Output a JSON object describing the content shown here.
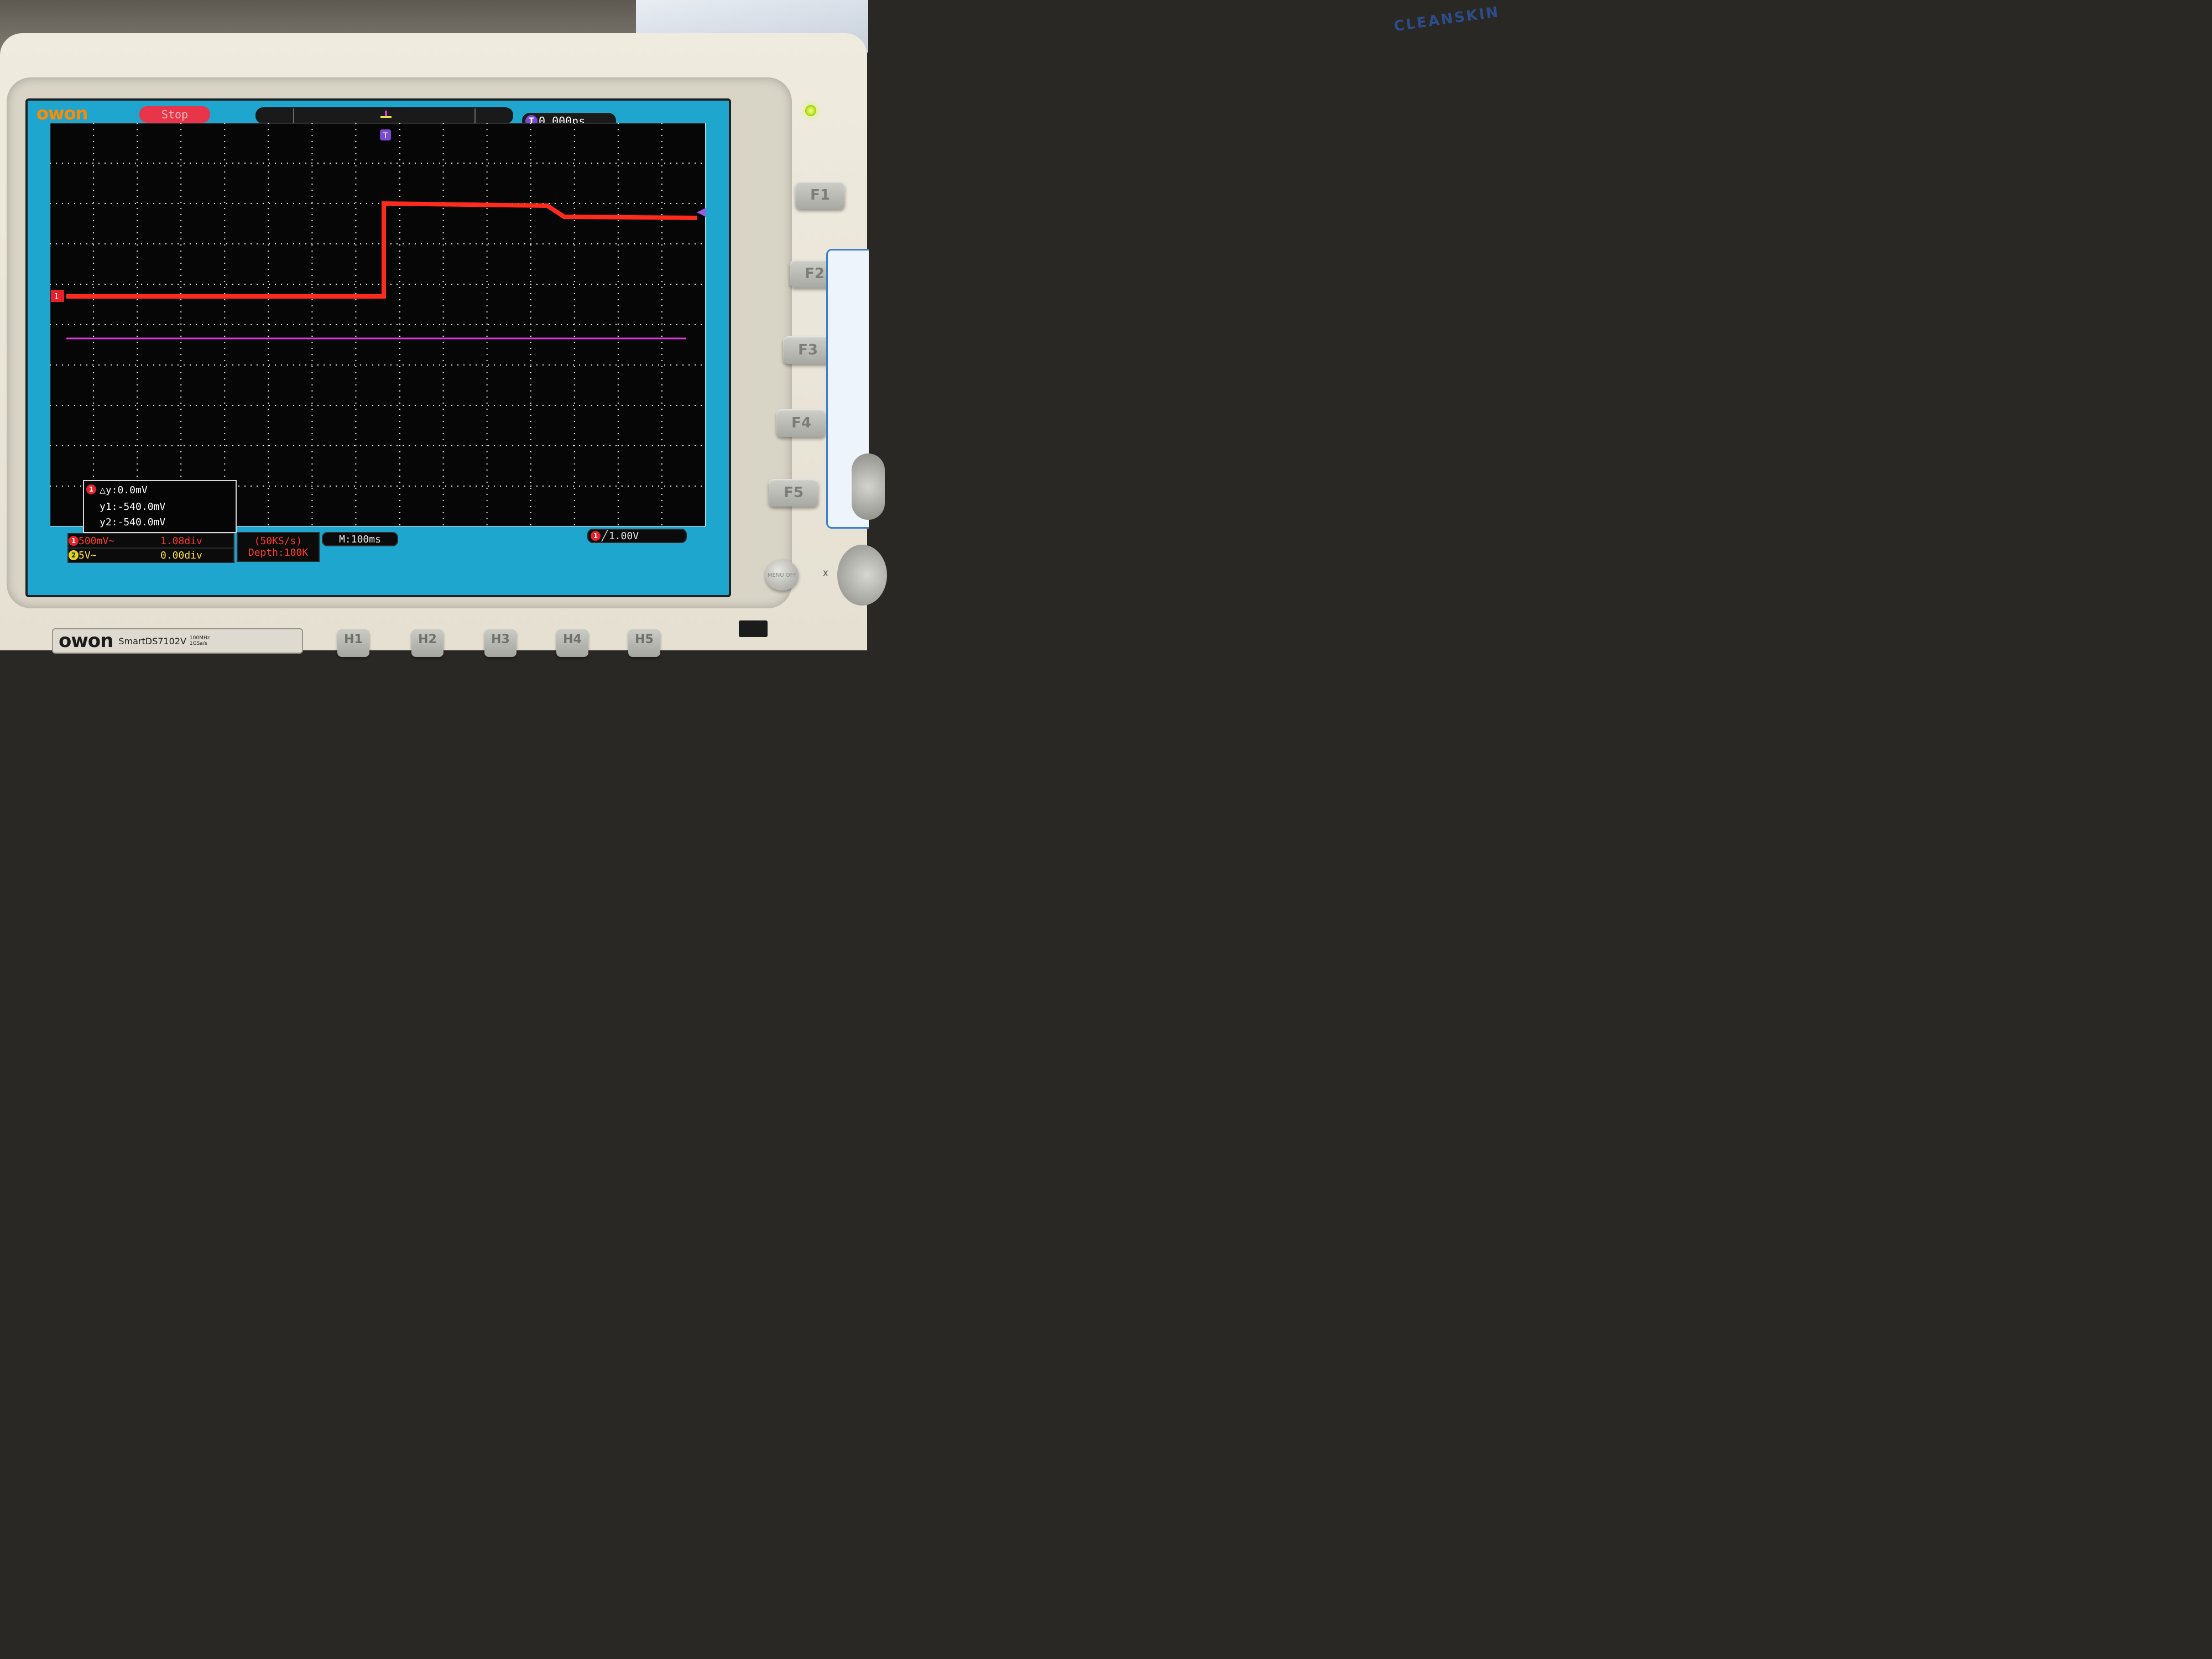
{
  "scope": {
    "brand_logo": "owon",
    "run_state": "Stop",
    "trigger_delay": "0.000ns",
    "trigger_marker": "T",
    "channel1_marker": "1",
    "colors": {
      "screen_bg": "#1fa6cf",
      "ch1": "#ff2b1c",
      "ch2_trace": "#d83bd8",
      "grid": "#f2f2f2"
    },
    "cursor": {
      "channel": "1",
      "delta_y": "△y:0.0mV",
      "y1": "y1:-540.0mV",
      "y2": "y2:-540.0mV"
    },
    "ch1": {
      "badge": "1",
      "scale": "500mV~",
      "offset": "1.08div"
    },
    "ch2": {
      "badge": "2",
      "scale": "5V~",
      "offset": "0.00div"
    },
    "sample_rate": "(50KS/s)",
    "depth": "Depth:100K",
    "timebase": "M:100ms",
    "trigger": {
      "badge": "1",
      "level": "1.00V"
    }
  },
  "panel": {
    "function_buttons": [
      "F1",
      "F2",
      "F3",
      "F4",
      "F5"
    ],
    "horizontal_buttons": [
      "H1",
      "H2",
      "H3",
      "H4",
      "H5"
    ],
    "menu_button": "MENU OFF",
    "knob_label": "X",
    "brand": "owon",
    "model": "SmartDS7102V",
    "spec_line1": "100MHz",
    "spec_line2": "1GSa/s"
  },
  "background": {
    "box_text": "CLEANSKIN"
  }
}
